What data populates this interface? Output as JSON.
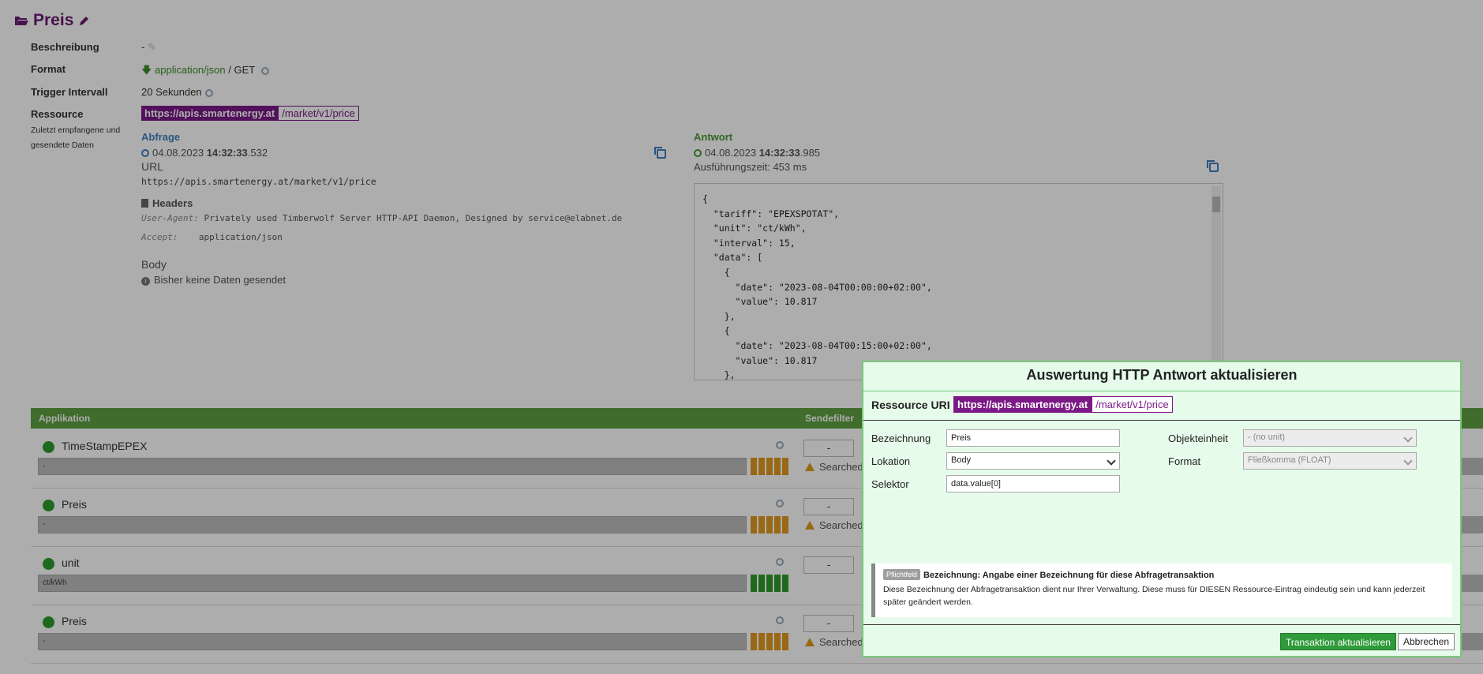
{
  "page": {
    "title": "Preis",
    "rows": {
      "beschreibung_label": "Beschreibung",
      "beschreibung_value": "-",
      "format_label": "Format",
      "format_type": "application/json",
      "format_method": "/ GET",
      "trigger_label": "Trigger Intervall",
      "trigger_value": "20 Sekunden",
      "ressource_label": "Ressource",
      "ressource_sub": "Zuletzt empfangene und gesendete Daten",
      "ressource_host": "https://apis.smartenergy.at",
      "ressource_path": "/market/v1/price"
    }
  },
  "request": {
    "heading": "Abfrage",
    "date": "04.08.2023",
    "time_bold": "14:32:33",
    "time_ms": ".532",
    "url_label": "URL",
    "url": "https://apis.smartenergy.at/market/v1/price",
    "headers_label": "Headers",
    "header1_key": "User-Agent:",
    "header1_val": "Privately used Timberwolf Server HTTP-API Daemon, Designed by service@elabnet.de",
    "header2_key": "Accept:",
    "header2_val": "application/json",
    "body_label": "Body",
    "body_value": "Bisher keine Daten gesendet"
  },
  "response": {
    "heading": "Antwort",
    "date": "04.08.2023",
    "time_bold": "14:32:33",
    "time_ms": ".985",
    "exec_label": "Ausführungszeit: 453 ms",
    "json": "{\n  \"tariff\": \"EPEXSPOTAT\",\n  \"unit\": \"ct/kWh\",\n  \"interval\": 15,\n  \"data\": [\n    {\n      \"date\": \"2023-08-04T00:00:00+02:00\",\n      \"value\": 10.817\n    },\n    {\n      \"date\": \"2023-08-04T00:15:00+02:00\",\n      \"value\": 10.817\n    },"
  },
  "table": {
    "col_app": "Applikation",
    "col_filter": "Sendefilter",
    "rows": [
      {
        "name": "TimeStampEPEX",
        "bar": "-",
        "filter": "-",
        "warn": "Searched",
        "stripe_color": "#e09a20"
      },
      {
        "name": "Preis",
        "bar": "-",
        "filter": "-",
        "warn": "Searched",
        "stripe_color": "#e09a20"
      },
      {
        "name": "unit",
        "bar": "ct/kWh",
        "filter": "-",
        "warn": "",
        "stripe_color": "#2e9b2e"
      },
      {
        "name": "Preis",
        "bar": "-",
        "filter": "-",
        "warn": "Searched",
        "stripe_color": "#e09a20"
      }
    ]
  },
  "modal": {
    "title": "Auswertung HTTP Antwort aktualisieren",
    "uri_label": "Ressource URI",
    "uri_host": "https://apis.smartenergy.at",
    "uri_path": "/market/v1/price",
    "bez_label": "Bezeichnung",
    "bez_value": "Preis",
    "lok_label": "Lokation",
    "lok_value": "Body",
    "sel_label": "Selektor",
    "sel_value": "data.value[0]",
    "obj_label": "Objekteinheit",
    "obj_value": "- (no unit)",
    "fmt_label": "Format",
    "fmt_value": "Fließkomma (FLOAT)",
    "badge": "Pflichtfeld",
    "info_title": "Bezeichnung: Angabe einer Bezeichnung für diese Abfragetransaktion",
    "info_text": "Diese Bezeichnung der Abfragetransaktion dient nur Ihrer Verwaltung. Diese muss für DIESEN Ressource-Eintrag eindeutig sein und kann jederzeit später geändert werden.",
    "btn_update": "Transaktion aktualisieren",
    "btn_cancel": "Abbrechen"
  }
}
